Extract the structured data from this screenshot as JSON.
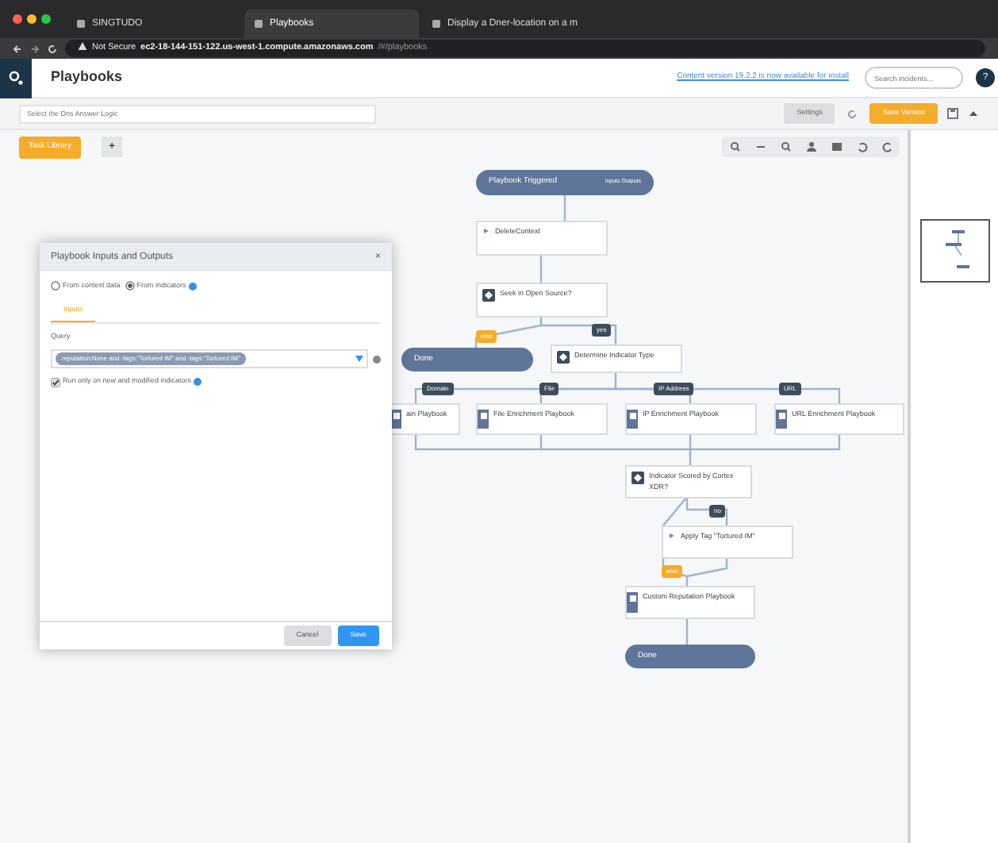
{
  "browser": {
    "tabs": [
      {
        "title": "SINGTUDO",
        "selected": false
      },
      {
        "title": "Playbooks",
        "selected": true
      },
      {
        "title": "Display a Dner-location on a m",
        "selected": false
      }
    ],
    "address": {
      "security": "Not Secure",
      "url": "ec2-18-144-151-122.us-west-1.compute.amazonaws.com",
      "path": "/#/playbooks"
    }
  },
  "header": {
    "title": "Playbooks",
    "notice": "Content version 19.2.2 is now available for install",
    "search": {
      "placeholder": "Search incidents..."
    },
    "help": "?"
  },
  "toolbar": {
    "name_field": {
      "placeholder": "Select the Dns Answer Logic"
    },
    "buttons": [
      "Settings",
      "Save Version"
    ],
    "task_library": "Task Library",
    "add": "+"
  },
  "nodes": [
    {
      "kind": "terminal",
      "label": "Playbook Triggered",
      "extra": "Inputs Outputs"
    },
    {
      "kind": "task",
      "label": "DeleteContext"
    },
    {
      "kind": "condition",
      "label": "Seek in Open Source?"
    },
    {
      "kind": "terminal",
      "label": "Done"
    },
    {
      "kind": "condition",
      "label": "Determine Indicator Type"
    },
    {
      "kind": "playbook",
      "label": "ain Playbook"
    },
    {
      "kind": "playbook",
      "label": "File Enrichment Playbook"
    },
    {
      "kind": "playbook",
      "label": "IP Enrichment Playbook"
    },
    {
      "kind": "playbook",
      "label": "URL Enrichment Playbook"
    },
    {
      "kind": "condition",
      "label": "Indicator Scored by Cortex XDR?"
    },
    {
      "kind": "task",
      "label": "Apply Tag \"Tortured IM\""
    },
    {
      "kind": "playbook",
      "label": "Custom Reputation Playbook"
    },
    {
      "kind": "terminal",
      "label": "Done"
    }
  ],
  "branch_labels": [
    {
      "label": "else",
      "kind": "else"
    },
    {
      "label": "yes",
      "kind": "branch"
    },
    {
      "label": "Domain",
      "kind": "branch"
    },
    {
      "label": "File",
      "kind": "branch"
    },
    {
      "label": "IP Address",
      "kind": "branch"
    },
    {
      "label": "URL",
      "kind": "branch"
    },
    {
      "label": "no",
      "kind": "branch"
    },
    {
      "label": "else",
      "kind": "else"
    }
  ],
  "dialog": {
    "title": "Playbook Inputs and Outputs",
    "close": "×",
    "sources": [
      {
        "label": "From context data",
        "selected": false
      },
      {
        "label": "From indicators",
        "selected": true
      }
    ],
    "tabs": [
      {
        "label": "Inputs",
        "selected": true
      }
    ],
    "query_label": "Query",
    "query_chip": "reputation:None and -tags:\"Tortured IM\" and -tags:\"Tortured IM\"",
    "run_only": {
      "label": "Run only on new and modified indicators",
      "checked": true
    },
    "buttons": [
      "Cancel",
      "Save"
    ]
  }
}
